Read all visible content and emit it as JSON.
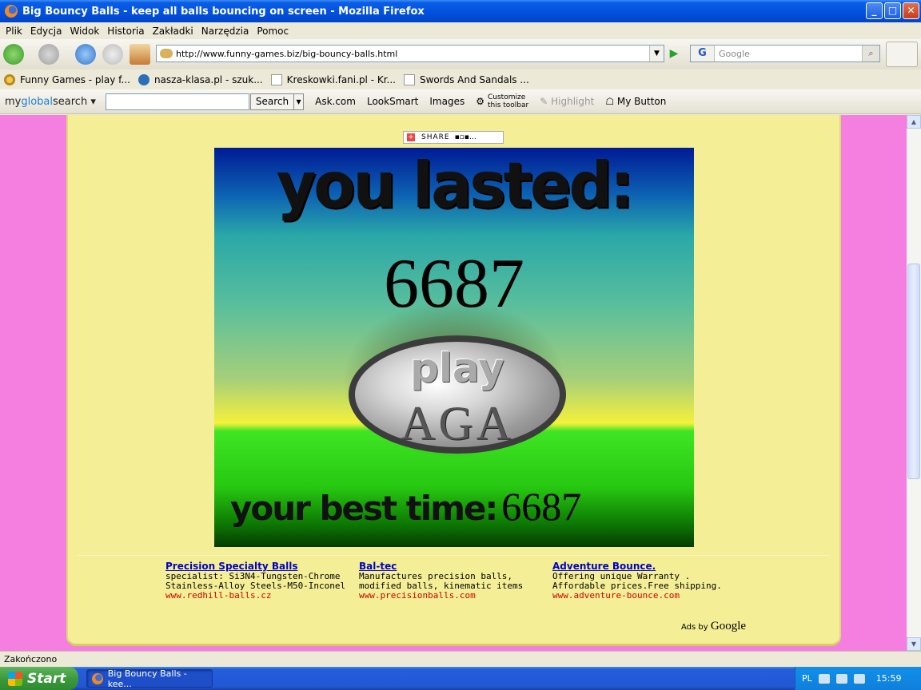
{
  "window": {
    "title": "Big Bouncy Balls - keep all balls bouncing on screen - Mozilla Firefox",
    "min": "_",
    "max": "□",
    "close": "✕"
  },
  "menu": [
    "Plik",
    "Edycja",
    "Widok",
    "Historia",
    "Zakładki",
    "Narzędzia",
    "Pomoc"
  ],
  "nav": {
    "url": "http://www.funny-games.biz/big-bouncy-balls.html",
    "search_placeholder": "Google",
    "search_engine": "G"
  },
  "bookmarks": [
    {
      "label": "Funny Games - play f...",
      "icon": "funnygames-icon"
    },
    {
      "label": "nasza-klasa.pl - szuk...",
      "icon": "naszaklasa-icon"
    },
    {
      "label": "Kreskowki.fani.pl - Kr...",
      "icon": "page-icon"
    },
    {
      "label": "Swords And Sandals ...",
      "icon": "page-icon"
    }
  ],
  "toolbar": {
    "logo_my": "my",
    "logo_global": "global",
    "logo_search": "search",
    "search_label": "Search",
    "links": [
      "Ask.com",
      "LookSmart",
      "Images"
    ],
    "customize": "Customize\nthis toolbar",
    "highlight": "Highlight",
    "my_button": "My Button"
  },
  "share_label": "SHARE",
  "game": {
    "lasted_label": "you lasted:",
    "score": "6687",
    "play_word": "play",
    "again_word": "AGA",
    "best_label": "your best time:",
    "best_value": "6687"
  },
  "ads": [
    {
      "title": "Precision Specialty Balls",
      "desc": "specialist: Si3N4-Tungsten-Chrome Stainless-Alloy Steels-M50-Inconel",
      "url": "www.redhill-balls.cz"
    },
    {
      "title": "Bal-tec",
      "desc": "Manufactures precision balls, modified balls, kinematic items",
      "url": "www.precisionballs.com"
    },
    {
      "title": "Adventure Bounce.",
      "desc": "Offering unique Warranty . Affordable prices.Free shipping.",
      "url": "www.adventure-bounce.com"
    }
  ],
  "ads_by": "Ads by",
  "ads_brand": "Google",
  "status": "Zakończono",
  "taskbar": {
    "start": "Start",
    "task": "Big Bouncy Balls - kee...",
    "lang": "PL",
    "clock": "15:59"
  },
  "colors": {
    "page_bg": "#f57fe0",
    "panel_bg": "#f4ef96",
    "ad_title": "#0000cc",
    "ad_url": "#cc0000"
  }
}
